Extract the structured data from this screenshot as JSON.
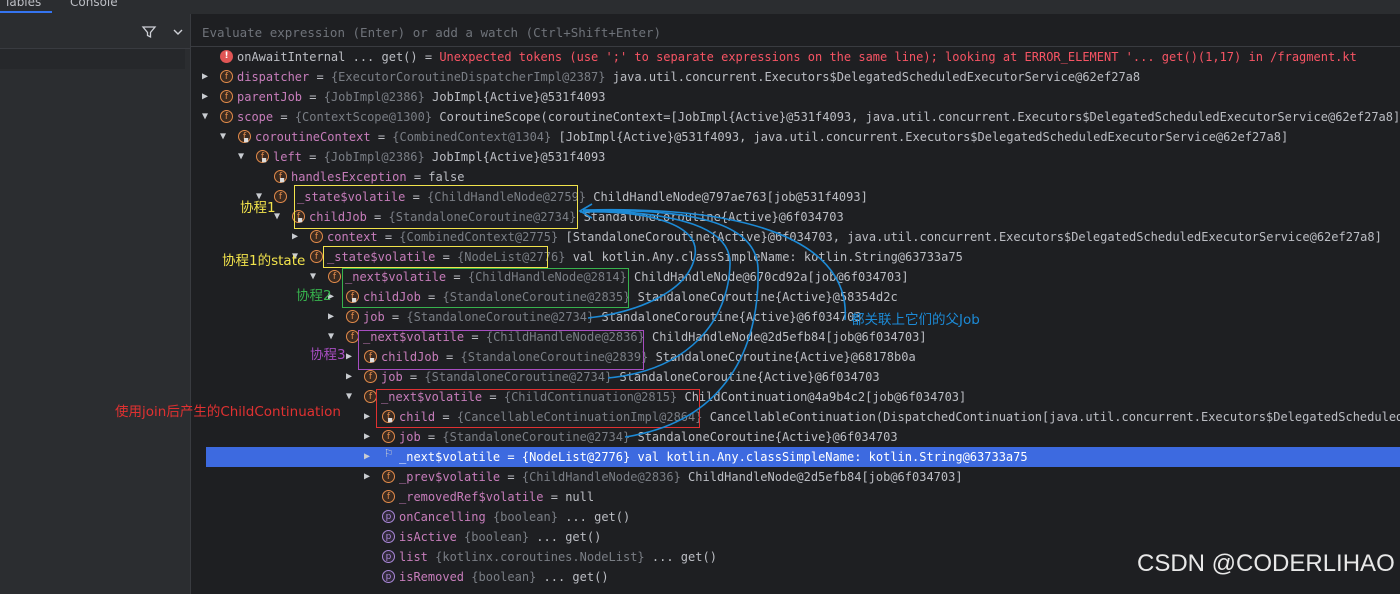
{
  "tabs": {
    "variables_label": "iables",
    "console_label": "Console"
  },
  "evaluate": {
    "placeholder": "Evaluate expression (Enter) or add a watch (Ctrl+Shift+Enter)"
  },
  "error_row": {
    "name": "onAwaitInternal ... get()",
    "message": "Unexpected tokens (use ';' to separate expressions on the same line); looking at ERROR_ELEMENT '... get()(1,17) in /fragment.kt"
  },
  "rows": [
    {
      "name": "dispatcher",
      "type": "{ExecutorCoroutineDispatcherImpl@2387}",
      "value": "java.util.concurrent.Executors$DelegatedScheduledExecutorService@62ef27a8"
    },
    {
      "name": "parentJob",
      "type": "{JobImpl@2386}",
      "value": "JobImpl{Active}@531f4093"
    },
    {
      "name": "scope",
      "type": "{ContextScope@1300}",
      "value": "CoroutineScope(coroutineContext=[JobImpl{Active}@531f4093, java.util.concurrent.Executors$DelegatedScheduledExecutorService@62ef27a8])"
    },
    {
      "name": "coroutineContext",
      "type": "{CombinedContext@1304}",
      "value": "[JobImpl{Active}@531f4093, java.util.concurrent.Executors$DelegatedScheduledExecutorService@62ef27a8]"
    },
    {
      "name": "left",
      "type": "{JobImpl@2386}",
      "value": "JobImpl{Active}@531f4093"
    },
    {
      "name": "handlesException",
      "type": "",
      "value": "false"
    },
    {
      "name": "_state$volatile",
      "type": "{ChildHandleNode@2759}",
      "value": "ChildHandleNode@797ae763[job@531f4093]"
    },
    {
      "name": "childJob",
      "type": "{StandaloneCoroutine@2734}",
      "value": "StandaloneCoroutine{Active}@6f034703"
    },
    {
      "name": "context",
      "type": "{CombinedContext@2775}",
      "value": "[StandaloneCoroutine{Active}@6f034703, java.util.concurrent.Executors$DelegatedScheduledExecutorService@62ef27a8]"
    },
    {
      "name": "_state$volatile",
      "type": "{NodeList@2776}",
      "value": "val kotlin.Any.classSimpleName: kotlin.String@63733a75"
    },
    {
      "name": "_next$volatile",
      "type": "{ChildHandleNode@2814}",
      "value": "ChildHandleNode@670cd92a[job@6f034703]"
    },
    {
      "name": "childJob",
      "type": "{StandaloneCoroutine@2835}",
      "value": "StandaloneCoroutine{Active}@58354d2c"
    },
    {
      "name": "job",
      "type": "{StandaloneCoroutine@2734}",
      "value": "StandaloneCoroutine{Active}@6f034703"
    },
    {
      "name": "_next$volatile",
      "type": "{ChildHandleNode@2836}",
      "value": "ChildHandleNode@2d5efb84[job@6f034703]"
    },
    {
      "name": "childJob",
      "type": "{StandaloneCoroutine@2839}",
      "value": "StandaloneCoroutine{Active}@68178b0a"
    },
    {
      "name": "job",
      "type": "{StandaloneCoroutine@2734}",
      "value": "StandaloneCoroutine{Active}@6f034703"
    },
    {
      "name": "_next$volatile",
      "type": "{ChildContinuation@2815}",
      "value": "ChildContinuation@4a9b4c2[job@6f034703]"
    },
    {
      "name": "child",
      "type": "{CancellableContinuationImpl@2864}",
      "value": "CancellableContinuation(DispatchedContinuation[java.util.concurrent.Executors$DelegatedScheduledExec"
    },
    {
      "name": "job",
      "type": "{StandaloneCoroutine@2734}",
      "value": "StandaloneCoroutine{Active}@6f034703"
    },
    {
      "name": "_next$volatile",
      "type": "{NodeList@2776}",
      "value": "val kotlin.Any.classSimpleName: kotlin.String@63733a75"
    },
    {
      "name": "_prev$volatile",
      "type": "{ChildHandleNode@2836}",
      "value": "ChildHandleNode@2d5efb84[job@6f034703]"
    },
    {
      "name": "_removedRef$volatile",
      "type": "",
      "value": "null"
    },
    {
      "name": "onCancelling",
      "type": "{boolean}",
      "value": "... get()"
    },
    {
      "name": "isActive",
      "type": "{boolean}",
      "value": "... get()"
    },
    {
      "name": "list",
      "type": "{kotlinx.coroutines.NodeList}",
      "value": "... get()"
    },
    {
      "name": "isRemoved",
      "type": "{boolean}",
      "value": "... get()"
    }
  ],
  "annotations": {
    "coroutine1": "协程1",
    "coroutine1_state": "协程1的state",
    "coroutine2": "协程2",
    "coroutine3": "协程3",
    "parent_job_note": "都关联上它们的父Job",
    "join_note": "使用join后产生的ChildContinuation"
  },
  "colors": {
    "yellow": "#f2e34c",
    "green": "#37b24d",
    "purple": "#a64dc0",
    "red": "#e03131",
    "blue": "#1c8ad6",
    "selection": "#3d6ae0"
  },
  "watermark": "CSDN @CODERLIHAO"
}
